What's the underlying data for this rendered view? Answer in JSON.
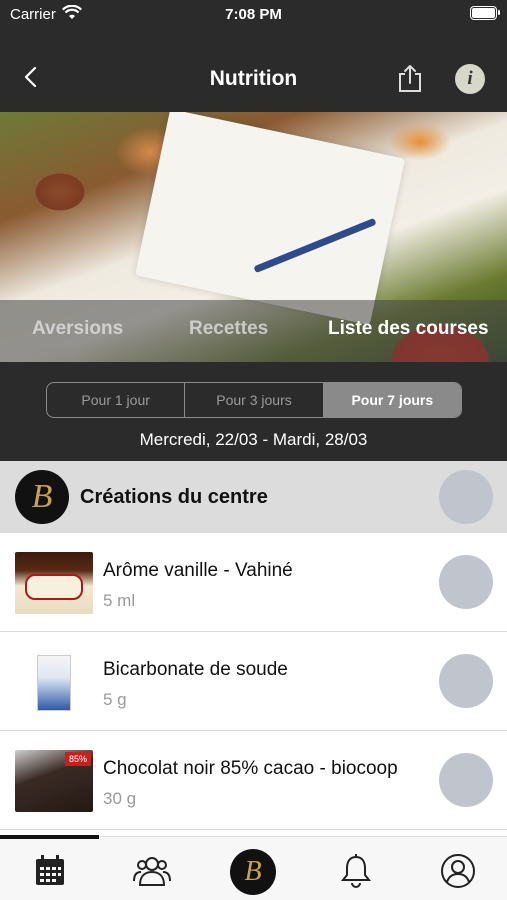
{
  "status_bar": {
    "carrier": "Carrier",
    "time": "7:08 PM"
  },
  "nav": {
    "title": "Nutrition",
    "back_icon": "chevron-left-icon",
    "share_icon": "share-icon",
    "info_icon": "info-icon"
  },
  "tabs": [
    {
      "label": "Aversions",
      "active": false
    },
    {
      "label": "Recettes",
      "active": false
    },
    {
      "label": "Liste des courses",
      "active": true
    }
  ],
  "periods": [
    {
      "label": "Pour 1 jour",
      "selected": false
    },
    {
      "label": "Pour 3 jours",
      "selected": false
    },
    {
      "label": "Pour 7 jours",
      "selected": true
    }
  ],
  "date_range": "Mercredi, 22/03 - Mardi, 28/03",
  "section": {
    "title": "Créations du centre",
    "logo_letter": "B"
  },
  "items": [
    {
      "name": "Arôme vanille - Vahiné",
      "quantity": "5 ml"
    },
    {
      "name": "Bicarbonate de soude",
      "quantity": "5 g"
    },
    {
      "name": "Chocolat noir 85% cacao - biocoop",
      "quantity": "30 g"
    }
  ],
  "thumb_labels": {
    "chocolate_tag": "85%"
  },
  "tab_bar": {
    "items": [
      "calendar-icon",
      "community-icon",
      "brand-logo",
      "bell-icon",
      "profile-icon"
    ],
    "center_letter": "B"
  },
  "colors": {
    "dark_bg": "#2b2b2b",
    "check_circle": "#c0c4cc",
    "section_bg": "#dcdcdc",
    "brand_gold": "#c9a24a"
  }
}
